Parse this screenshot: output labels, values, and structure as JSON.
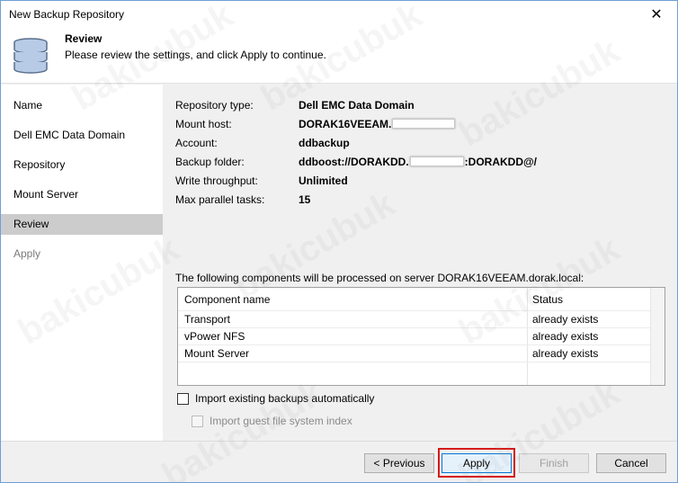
{
  "window": {
    "title": "New Backup Repository"
  },
  "header": {
    "title": "Review",
    "subtitle": "Please review the settings, and click Apply to continue."
  },
  "steps": [
    {
      "label": "Name",
      "state": "normal"
    },
    {
      "label": "Dell EMC Data Domain",
      "state": "normal"
    },
    {
      "label": "Repository",
      "state": "normal"
    },
    {
      "label": "Mount Server",
      "state": "normal"
    },
    {
      "label": "Review",
      "state": "active"
    },
    {
      "label": "Apply",
      "state": "disabled"
    }
  ],
  "summary": [
    {
      "label": "Repository type:",
      "value": "Dell EMC Data Domain"
    },
    {
      "label": "Mount host:",
      "value": "DORAK16VEEAM."
    },
    {
      "label": "Account:",
      "value": "ddbackup"
    },
    {
      "label": "Backup folder:",
      "value_a": "ddboost://DORAKDD.",
      "value_b": ":DORAKDD@/"
    },
    {
      "label": "Write throughput:",
      "value": "Unlimited"
    },
    {
      "label": "Max parallel tasks:",
      "value": "15"
    }
  ],
  "components": {
    "caption": "The following components will be processed on server DORAK16VEEAM.dorak.local:",
    "columns": [
      "Component name",
      "Status"
    ],
    "rows": [
      {
        "name": "Transport",
        "status": "already exists"
      },
      {
        "name": "vPower NFS",
        "status": "already exists"
      },
      {
        "name": "Mount Server",
        "status": "already exists"
      }
    ]
  },
  "options": {
    "import_backups": {
      "label": "Import existing backups automatically",
      "checked": false
    },
    "import_index": {
      "label": "Import guest file system index",
      "checked": false,
      "enabled": false
    }
  },
  "buttons": {
    "previous": "< Previous",
    "apply": "Apply",
    "finish": "Finish",
    "cancel": "Cancel"
  },
  "icons": {
    "close": "close-icon",
    "header": "database-repository-icon"
  },
  "colors": {
    "highlight": "#d61a1a",
    "active_step": "#cccccc",
    "accent": "#0078d7",
    "icon_fill": "#b7cbe6"
  },
  "watermark": "bakicubuk"
}
